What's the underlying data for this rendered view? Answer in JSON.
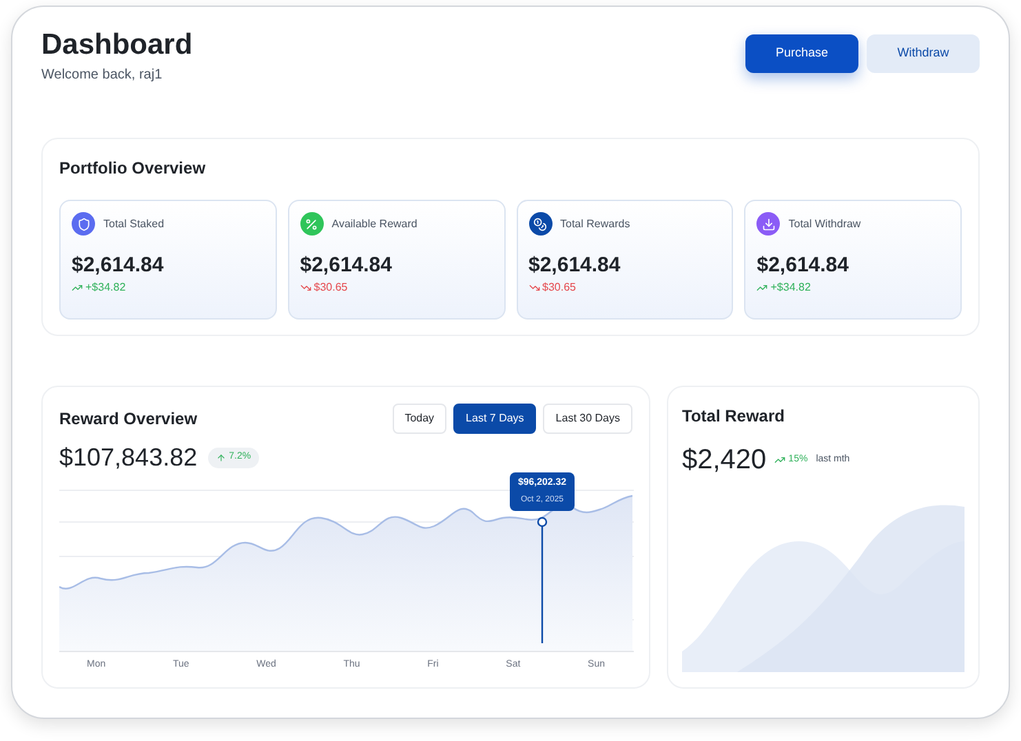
{
  "header": {
    "title": "Dashboard",
    "subtitle": "Welcome back, raj1",
    "buttons": [
      {
        "label": "Purchase",
        "kind": "primary"
      },
      {
        "label": "Withdraw",
        "kind": "secondary"
      }
    ]
  },
  "portfolio": {
    "title": "Portfolio Overview",
    "cards": [
      {
        "label": "Total Staked",
        "value": "$2,614.84",
        "change": "+$34.82",
        "kind": "gain",
        "color": "#5b6cf0"
      },
      {
        "label": "Available Reward",
        "value": "$2,614.84",
        "change": "$30.65",
        "kind": "loss",
        "color": "#2fc55a"
      },
      {
        "label": "Total Rewards",
        "value": "$2,614.84",
        "change": "$30.65",
        "kind": "loss",
        "color": "#0b4aa8"
      },
      {
        "label": "Total Withdraw",
        "value": "$2,614.84",
        "change": "+$34.82",
        "kind": "gain",
        "color": "#8b5cf6"
      }
    ]
  },
  "reward_overview": {
    "title": "Reward Overview",
    "total": "$107,843.82",
    "badge": "7.2%",
    "ranges": [
      {
        "label": "Today",
        "selected": false
      },
      {
        "label": "Last 7 Days",
        "selected": true
      },
      {
        "label": "Last 30 Days",
        "selected": false
      }
    ],
    "tooltip": {
      "value": "$96,202.32",
      "date": "Oct 2, 2025"
    },
    "days": [
      "Mon",
      "Tue",
      "Wed",
      "Thu",
      "Fri",
      "Sat",
      "Sun"
    ]
  },
  "total_reward": {
    "title": "Total Reward",
    "value": "$2,420",
    "change": "15%",
    "period": "last mth"
  }
}
